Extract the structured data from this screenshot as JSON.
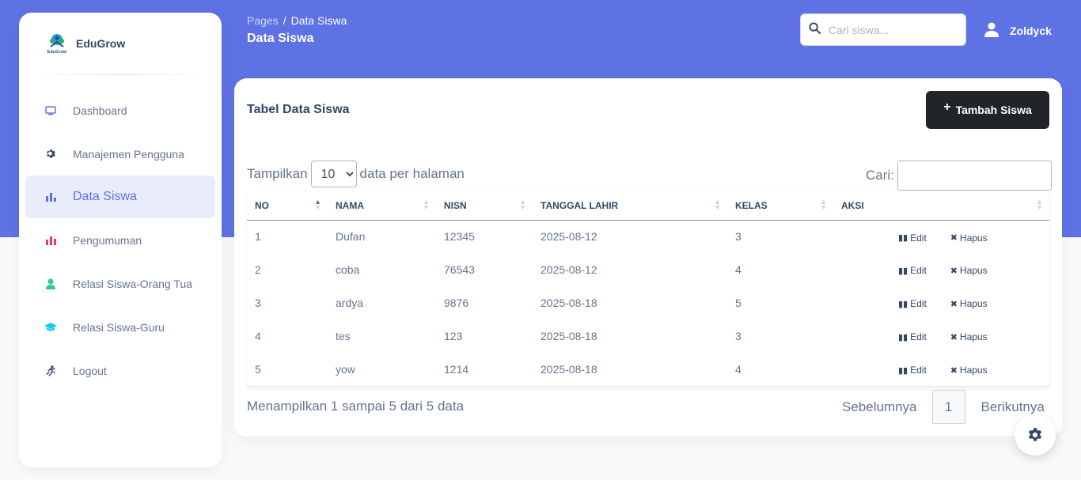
{
  "brand": {
    "name": "EduGrow",
    "logo_text": "EduGrow"
  },
  "sidebar": {
    "items": [
      {
        "label": "Dashboard",
        "icon": "monitor-icon",
        "color": "#5e72e4"
      },
      {
        "label": "Manajemen Pengguna",
        "icon": "gear-icon",
        "color": "#344767"
      },
      {
        "label": "Data Siswa",
        "icon": "bar-chart-icon",
        "color": "#5e72e4",
        "active": true
      },
      {
        "label": "Pengumuman",
        "icon": "bar-chart-icon",
        "color": "#f5365c"
      },
      {
        "label": "Relasi Siswa-Orang Tua",
        "icon": "user-icon",
        "color": "#2dce89"
      },
      {
        "label": "Relasi Siswa-Guru",
        "icon": "graduation-cap-icon",
        "color": "#11cdef"
      },
      {
        "label": "Logout",
        "icon": "running-icon",
        "color": "#344767"
      }
    ]
  },
  "header": {
    "breadcrumb_root": "Pages",
    "breadcrumb_sep": "/",
    "breadcrumb_current": "Data Siswa",
    "title": "Data Siswa",
    "search_placeholder": "Cari siswa...",
    "user_name": "Zoldyck"
  },
  "card": {
    "title": "Tabel Data Siswa",
    "add_button": "Tambah Siswa",
    "length_prefix": "Tampilkan",
    "length_value": "10",
    "length_suffix": "data per halaman",
    "filter_label": "Cari:",
    "columns": [
      "NO",
      "NAMA",
      "NISN",
      "TANGGAL LAHIR",
      "KELAS",
      "AKSI"
    ],
    "rows": [
      {
        "no": "1",
        "nama": "Dufan",
        "nisn": "12345",
        "tanggal": "2025-08-12",
        "kelas": "3"
      },
      {
        "no": "2",
        "nama": "coba",
        "nisn": "76543",
        "tanggal": "2025-08-12",
        "kelas": "4"
      },
      {
        "no": "3",
        "nama": "ardya",
        "nisn": "9876",
        "tanggal": "2025-08-18",
        "kelas": "5"
      },
      {
        "no": "4",
        "nama": "tes",
        "nisn": "123",
        "tanggal": "2025-08-18",
        "kelas": "3"
      },
      {
        "no": "5",
        "nama": "yow",
        "nisn": "1214",
        "tanggal": "2025-08-18",
        "kelas": "4"
      }
    ],
    "edit_label": "Edit",
    "delete_label": "Hapus",
    "info": "Menampilkan 1 sampai 5 dari 5 data",
    "prev_label": "Sebelumnya",
    "current_page": "1",
    "next_label": "Berikutnya"
  },
  "colors": {
    "primary": "#5e72e4",
    "dark": "#212529",
    "text": "#344767",
    "muted": "#67748e"
  }
}
